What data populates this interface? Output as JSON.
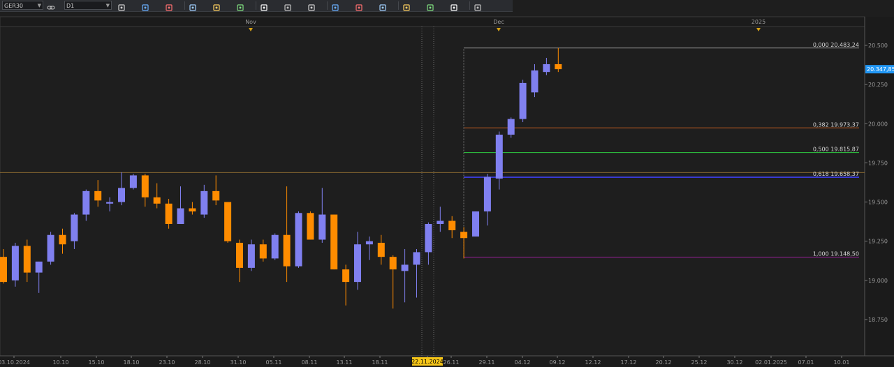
{
  "toolbar": {
    "symbol": "GER30",
    "timeframe": "D1",
    "tools": [
      "chart-type-icon",
      "period-icon",
      "crosshair-icon",
      "zoom-in-icon",
      "zoom-out-icon",
      "tile-icon",
      "line-icon",
      "text-icon",
      "fibonacci-icon",
      "template-icon",
      "indicator-icon",
      "pen-icon",
      "object-icon",
      "grid-icon",
      "eraser-icon",
      "signal-icon"
    ]
  },
  "colors": {
    "background": "#1e1e1e",
    "bull": "#8080f0",
    "bear": "#ff8c00",
    "grid": "#2e2e2e",
    "axis_text": "#9a9a9a",
    "price_tag_bg": "#2196f3",
    "date_tag_bg": "#f5c518"
  },
  "chart_data": {
    "type": "candlestick",
    "symbol": "GER30",
    "timeframe": "D1",
    "ylim": [
      18600,
      20600
    ],
    "y_ticks": [
      "20.500",
      "20.250",
      "20.000",
      "19.750",
      "19.500",
      "19.250",
      "19.000",
      "18.750"
    ],
    "x_ticks": [
      "03.10.2024",
      "10.10",
      "15.10",
      "18.10",
      "23.10",
      "28.10",
      "31.10",
      "05.11",
      "08.11",
      "13.11",
      "18.11",
      "22.11.2024",
      "26.11",
      "29.11",
      "04.12",
      "09.12",
      "12.12",
      "17.12",
      "20.12",
      "25.12",
      "30.12",
      "02.01.2025",
      "07.01",
      "10.01"
    ],
    "period_markers": [
      "Nov",
      "Dec",
      "2025"
    ],
    "current_price": "20.347,85",
    "highlighted_date": "22.11.2024",
    "horizontal_line": 19688,
    "fibonacci": [
      {
        "label": "0,000 20.483,24",
        "price": 20483.24,
        "color": "#888888"
      },
      {
        "label": "0,382 19.973,37",
        "price": 19973.37,
        "color": "#c05a20"
      },
      {
        "label": "0,500 19.815,87",
        "price": 19815.87,
        "color": "#2ecc40"
      },
      {
        "label": "0,618 19.658,37",
        "price": 19658.37,
        "color": "#3a3ad0"
      },
      {
        "label": "1,000 19.148,50",
        "price": 19148.5,
        "color": "#a020a0"
      }
    ],
    "candles": [
      {
        "date": "03.10",
        "o": 19150,
        "h": 19200,
        "l": 18980,
        "c": 18990
      },
      {
        "date": "04.10",
        "o": 19000,
        "h": 19240,
        "l": 18960,
        "c": 19220
      },
      {
        "date": "07.10",
        "o": 19220,
        "h": 19260,
        "l": 18990,
        "c": 19050
      },
      {
        "date": "08.10",
        "o": 19050,
        "h": 19120,
        "l": 18920,
        "c": 19120
      },
      {
        "date": "09.10",
        "o": 19120,
        "h": 19310,
        "l": 19100,
        "c": 19290
      },
      {
        "date": "10.10",
        "o": 19290,
        "h": 19330,
        "l": 19170,
        "c": 19230
      },
      {
        "date": "11.10",
        "o": 19250,
        "h": 19430,
        "l": 19200,
        "c": 19420
      },
      {
        "date": "14.10",
        "o": 19420,
        "h": 19580,
        "l": 19380,
        "c": 19570
      },
      {
        "date": "15.10",
        "o": 19570,
        "h": 19640,
        "l": 19470,
        "c": 19510
      },
      {
        "date": "16.10",
        "o": 19490,
        "h": 19530,
        "l": 19440,
        "c": 19500
      },
      {
        "date": "17.10",
        "o": 19500,
        "h": 19690,
        "l": 19480,
        "c": 19590
      },
      {
        "date": "18.10",
        "o": 19590,
        "h": 19680,
        "l": 19580,
        "c": 19670
      },
      {
        "date": "21.10",
        "o": 19670,
        "h": 19680,
        "l": 19470,
        "c": 19530
      },
      {
        "date": "22.10",
        "o": 19530,
        "h": 19620,
        "l": 19460,
        "c": 19490
      },
      {
        "date": "23.10",
        "o": 19490,
        "h": 19520,
        "l": 19330,
        "c": 19360
      },
      {
        "date": "24.10",
        "o": 19360,
        "h": 19600,
        "l": 19360,
        "c": 19460
      },
      {
        "date": "25.10",
        "o": 19460,
        "h": 19500,
        "l": 19420,
        "c": 19440
      },
      {
        "date": "28.10",
        "o": 19420,
        "h": 19610,
        "l": 19400,
        "c": 19570
      },
      {
        "date": "29.10",
        "o": 19570,
        "h": 19670,
        "l": 19480,
        "c": 19510
      },
      {
        "date": "30.10",
        "o": 19500,
        "h": 19500,
        "l": 19240,
        "c": 19250
      },
      {
        "date": "31.10",
        "o": 19240,
        "h": 19260,
        "l": 18990,
        "c": 19080
      },
      {
        "date": "01.11",
        "o": 19080,
        "h": 19260,
        "l": 19060,
        "c": 19230
      },
      {
        "date": "04.11",
        "o": 19230,
        "h": 19260,
        "l": 19120,
        "c": 19140
      },
      {
        "date": "05.11",
        "o": 19140,
        "h": 19300,
        "l": 19130,
        "c": 19290
      },
      {
        "date": "06.11",
        "o": 19290,
        "h": 19600,
        "l": 18990,
        "c": 19090
      },
      {
        "date": "07.11",
        "o": 19090,
        "h": 19440,
        "l": 19080,
        "c": 19430
      },
      {
        "date": "08.11",
        "o": 19430,
        "h": 19440,
        "l": 19260,
        "c": 19260
      },
      {
        "date": "11.11",
        "o": 19260,
        "h": 19590,
        "l": 19240,
        "c": 19420
      },
      {
        "date": "12.11",
        "o": 19420,
        "h": 19420,
        "l": 19070,
        "c": 19070
      },
      {
        "date": "13.11",
        "o": 19070,
        "h": 19100,
        "l": 18840,
        "c": 18990
      },
      {
        "date": "14.11",
        "o": 18990,
        "h": 19310,
        "l": 18940,
        "c": 19230
      },
      {
        "date": "15.11",
        "o": 19230,
        "h": 19280,
        "l": 19130,
        "c": 19250
      },
      {
        "date": "18.11",
        "o": 19240,
        "h": 19290,
        "l": 19100,
        "c": 19150
      },
      {
        "date": "19.11",
        "o": 19150,
        "h": 19160,
        "l": 18820,
        "c": 19070
      },
      {
        "date": "20.11",
        "o": 19060,
        "h": 19200,
        "l": 18860,
        "c": 19100
      },
      {
        "date": "21.11",
        "o": 19100,
        "h": 19200,
        "l": 18890,
        "c": 19180
      },
      {
        "date": "22.11",
        "o": 19180,
        "h": 19370,
        "l": 19100,
        "c": 19360
      },
      {
        "date": "25.11",
        "o": 19360,
        "h": 19470,
        "l": 19310,
        "c": 19380
      },
      {
        "date": "26.11",
        "o": 19380,
        "h": 19410,
        "l": 19270,
        "c": 19320
      },
      {
        "date": "27.11",
        "o": 19310,
        "h": 19340,
        "l": 19140,
        "c": 19270
      },
      {
        "date": "28.11",
        "o": 19280,
        "h": 19440,
        "l": 19280,
        "c": 19440
      },
      {
        "date": "29.11",
        "o": 19440,
        "h": 19680,
        "l": 19350,
        "c": 19660
      },
      {
        "date": "02.12",
        "o": 19650,
        "h": 19950,
        "l": 19580,
        "c": 19930
      },
      {
        "date": "03.12",
        "o": 19930,
        "h": 20040,
        "l": 19910,
        "c": 20030
      },
      {
        "date": "04.12",
        "o": 20030,
        "h": 20280,
        "l": 20010,
        "c": 20260
      },
      {
        "date": "05.12",
        "o": 20200,
        "h": 20380,
        "l": 20170,
        "c": 20340
      },
      {
        "date": "06.12",
        "o": 20330,
        "h": 20420,
        "l": 20310,
        "c": 20380
      },
      {
        "date": "09.12",
        "o": 20380,
        "h": 20483,
        "l": 20330,
        "c": 20348
      }
    ]
  }
}
